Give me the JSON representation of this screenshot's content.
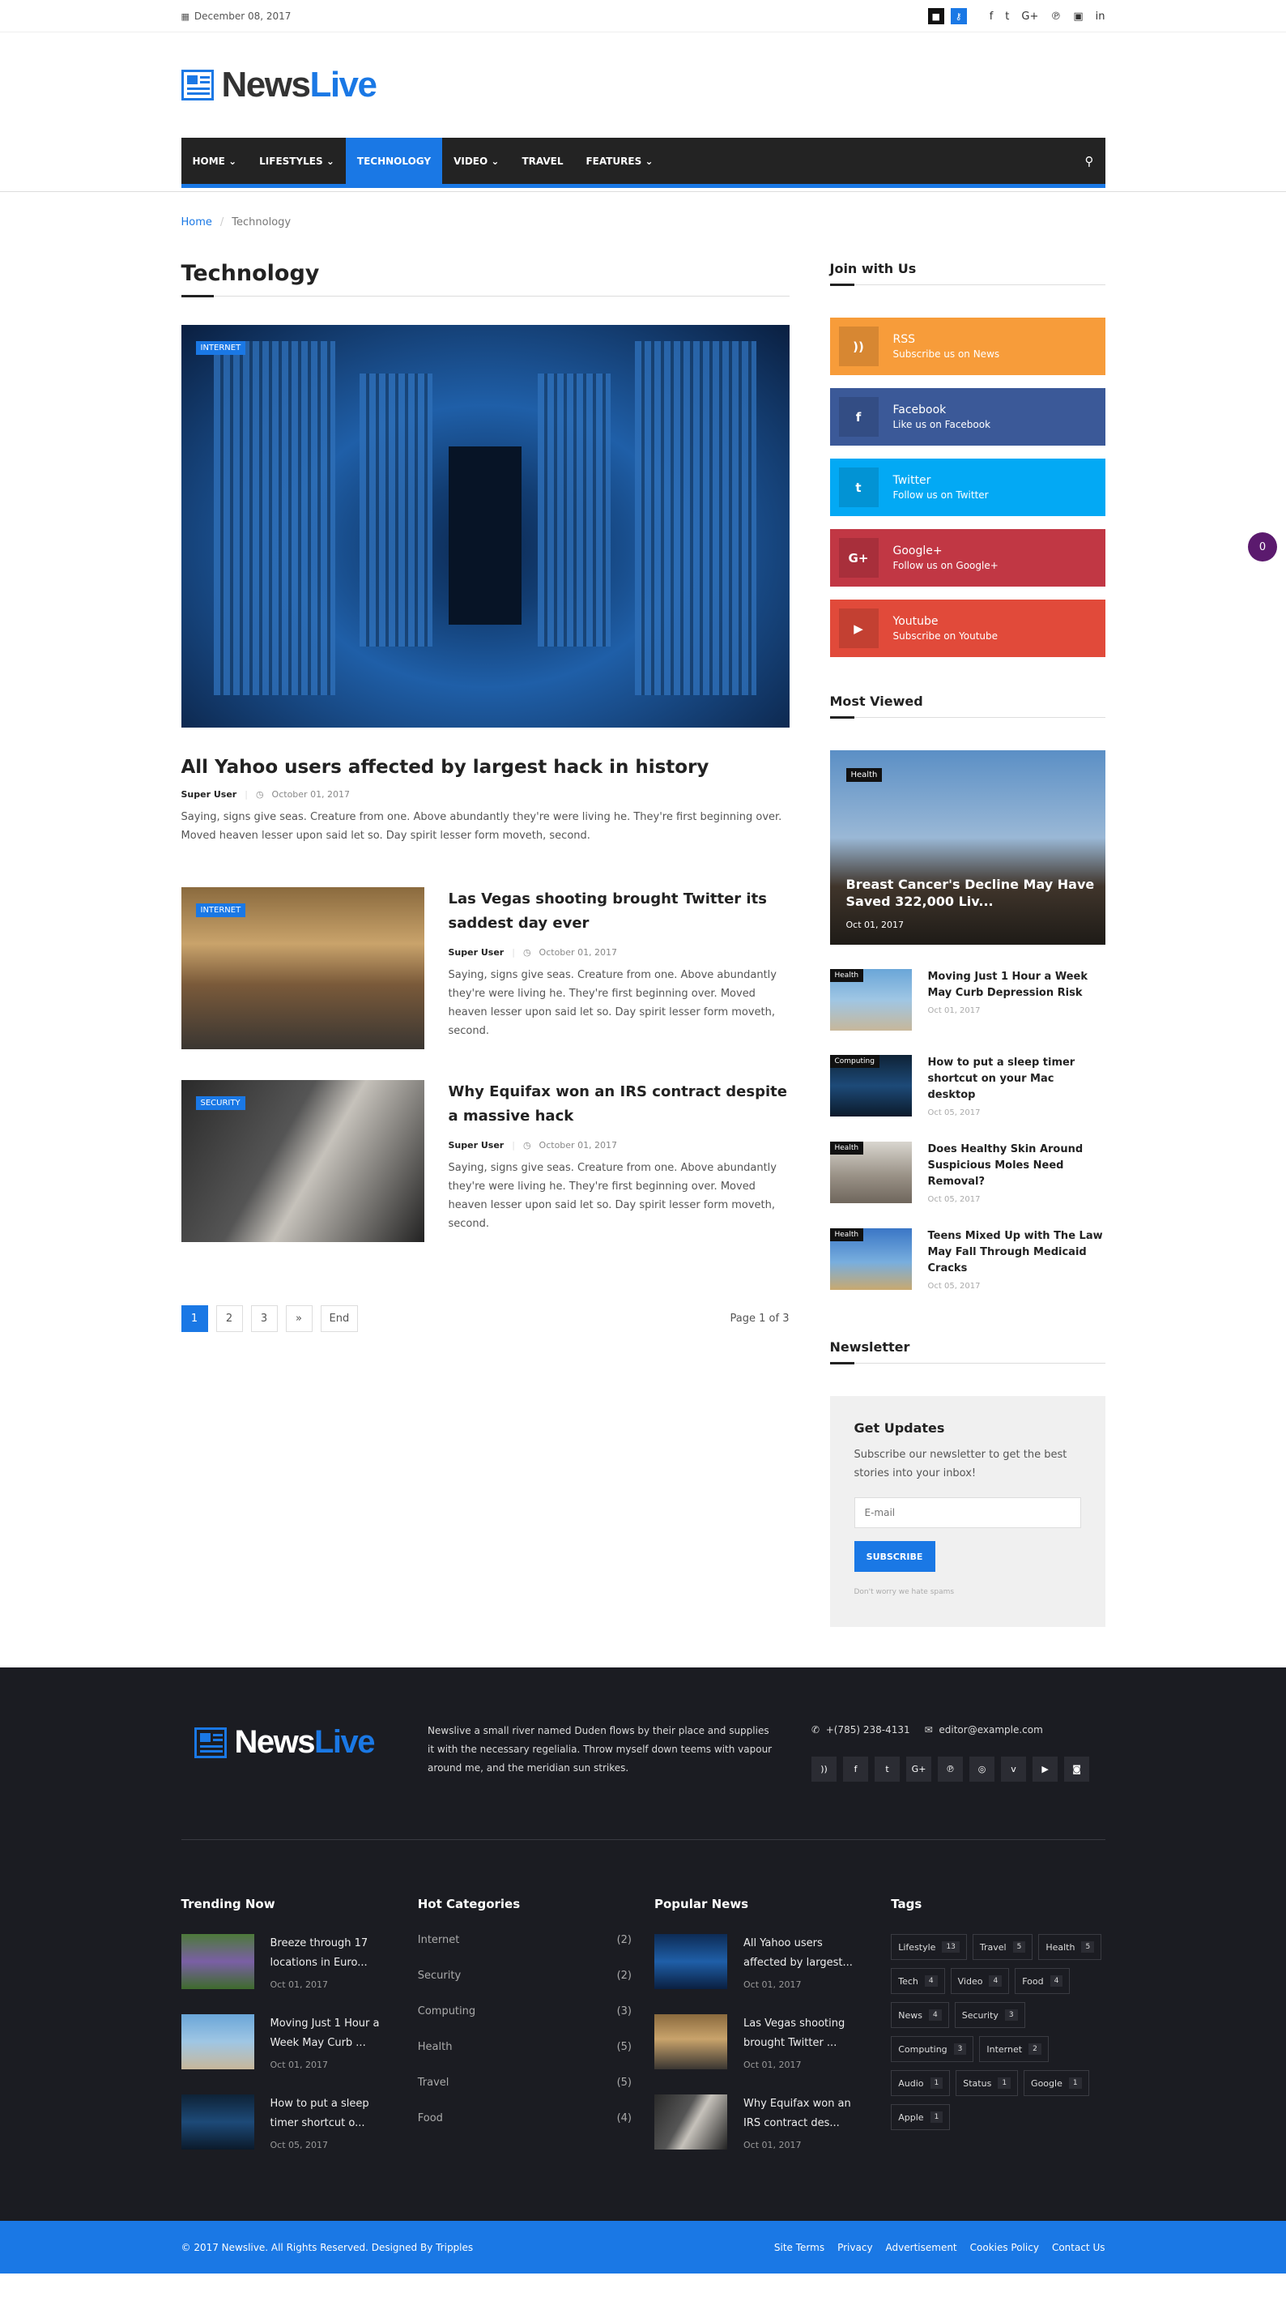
{
  "topbar": {
    "date": "December 08, 2017"
  },
  "brand": {
    "name_a": "News",
    "name_b": "Live"
  },
  "nav": [
    {
      "label": "HOME",
      "dropdown": true
    },
    {
      "label": "LIFESTYLES",
      "dropdown": true
    },
    {
      "label": "TECHNOLOGY",
      "dropdown": false,
      "active": true
    },
    {
      "label": "VIDEO",
      "dropdown": true
    },
    {
      "label": "TRAVEL",
      "dropdown": false
    },
    {
      "label": "FEATURES",
      "dropdown": true
    }
  ],
  "breadcrumb": {
    "home": "Home",
    "sep": "/",
    "current": "Technology"
  },
  "main": {
    "title": "Technology",
    "featured": {
      "tag": "INTERNET",
      "title": "All Yahoo users affected by largest hack in history",
      "author": "Super User",
      "date": "October 01, 2017",
      "excerpt": "Saying, signs give seas. Creature from one. Above abundantly they're were living he. They're first beginning over. Moved heaven lesser upon said let so. Day spirit lesser form moveth, second."
    },
    "posts": [
      {
        "tag": "INTERNET",
        "title": "Las Vegas shooting brought Twitter its saddest day ever",
        "author": "Super User",
        "date": "October 01, 2017",
        "excerpt": "Saying, signs give seas. Creature from one. Above abundantly they're were living he. They're first beginning over. Moved heaven lesser upon said let so. Day spirit lesser form moveth, second."
      },
      {
        "tag": "SECURITY",
        "title": "Why Equifax won an IRS contract despite a massive hack",
        "author": "Super User",
        "date": "October 01, 2017",
        "excerpt": "Saying, signs give seas. Creature from one. Above abundantly they're were living he. They're first beginning over. Moved heaven lesser upon said let so. Day spirit lesser form moveth, second."
      }
    ],
    "pagination": {
      "pages": [
        "1",
        "2",
        "3",
        "»",
        "End"
      ],
      "label": "Page 1 of 3"
    }
  },
  "sidebar": {
    "join_title": "Join with Us",
    "social": [
      {
        "name": "RSS",
        "sub": "Subscribe us on News",
        "icon": "rss-icon",
        "glyph": "))",
        "color": "#f79c3a"
      },
      {
        "name": "Facebook",
        "sub": "Like us on Facebook",
        "icon": "facebook-icon",
        "glyph": "f",
        "color": "#3b5998"
      },
      {
        "name": "Twitter",
        "sub": "Follow us on Twitter",
        "icon": "twitter-icon",
        "glyph": "t",
        "color": "#03a9f4"
      },
      {
        "name": "Google+",
        "sub": "Follow us on Google+",
        "icon": "google-plus-icon",
        "glyph": "G+",
        "color": "#c13744"
      },
      {
        "name": "Youtube",
        "sub": "Subscribe on Youtube",
        "icon": "youtube-icon",
        "glyph": "▶",
        "color": "#e14a3a"
      }
    ],
    "most_viewed_title": "Most Viewed",
    "most_viewed_big": {
      "tag": "Health",
      "title": "Breast Cancer's Decline May Have Saved 322,000 Liv...",
      "date": "Oct 01, 2017"
    },
    "most_viewed": [
      {
        "tag": "Health",
        "title": "Moving Just 1 Hour a Week May Curb Depression Risk",
        "date": "Oct 01, 2017"
      },
      {
        "tag": "Computing",
        "title": "How to put a sleep timer shortcut on your Mac desktop",
        "date": "Oct 05, 2017"
      },
      {
        "tag": "Health",
        "title": "Does Healthy Skin Around Suspicious Moles Need Removal?",
        "date": "Oct 05, 2017"
      },
      {
        "tag": "Health",
        "title": "Teens Mixed Up with The Law May Fall Through Medicaid Cracks",
        "date": "Oct 05, 2017"
      }
    ],
    "newsletter_title": "Newsletter",
    "newsletter": {
      "heading": "Get Updates",
      "text": "Subscribe our newsletter to get the best stories into your inbox!",
      "placeholder": "E-mail",
      "button": "SUBSCRIBE",
      "note": "Don't worry we hate spams"
    }
  },
  "counter": "0",
  "footer": {
    "about": "Newslive a small river named Duden flows by their place and supplies it with the necessary regelialia. Throw myself down teems with vapour around me, and the meridian sun strikes.",
    "phone": "+(785) 238-4131",
    "email": "editor@example.com",
    "trending_title": "Trending Now",
    "trending": [
      {
        "title": "Breeze through 17 locations in Euro...",
        "date": "Oct 01, 2017"
      },
      {
        "title": "Moving Just 1 Hour a Week May Curb ...",
        "date": "Oct 01, 2017"
      },
      {
        "title": "How to put a sleep timer shortcut o...",
        "date": "Oct 05, 2017"
      }
    ],
    "categories_title": "Hot Categories",
    "categories": [
      {
        "name": "Internet",
        "count": "(2)"
      },
      {
        "name": "Security",
        "count": "(2)"
      },
      {
        "name": "Computing",
        "count": "(3)"
      },
      {
        "name": "Health",
        "count": "(5)"
      },
      {
        "name": "Travel",
        "count": "(5)"
      },
      {
        "name": "Food",
        "count": "(4)"
      }
    ],
    "popular_title": "Popular News",
    "popular": [
      {
        "title": "All Yahoo users affected by largest...",
        "date": "Oct 01, 2017"
      },
      {
        "title": "Las Vegas shooting brought Twitter ...",
        "date": "Oct 01, 2017"
      },
      {
        "title": "Why Equifax won an IRS contract des...",
        "date": "Oct 01, 2017"
      }
    ],
    "tags_title": "Tags",
    "tags": [
      {
        "name": "Lifestyle",
        "count": "13"
      },
      {
        "name": "Travel",
        "count": "5"
      },
      {
        "name": "Health",
        "count": "5"
      },
      {
        "name": "Tech",
        "count": "4"
      },
      {
        "name": "Video",
        "count": "4"
      },
      {
        "name": "Food",
        "count": "4"
      },
      {
        "name": "News",
        "count": "4"
      },
      {
        "name": "Security",
        "count": "3"
      },
      {
        "name": "Computing",
        "count": "3"
      },
      {
        "name": "Internet",
        "count": "2"
      },
      {
        "name": "Audio",
        "count": "1"
      },
      {
        "name": "Status",
        "count": "1"
      },
      {
        "name": "Google",
        "count": "1"
      },
      {
        "name": "Apple",
        "count": "1"
      }
    ],
    "copyright": "© 2017 Newslive. All Rights Reserved. Designed By Tripples",
    "links": [
      "Site Terms",
      "Privacy",
      "Advertisement",
      "Cookies Policy",
      "Contact Us"
    ]
  },
  "colors": {
    "accent": "#1a78e5",
    "nav_bg": "#232323",
    "footer_bg": "#1b1c22"
  }
}
